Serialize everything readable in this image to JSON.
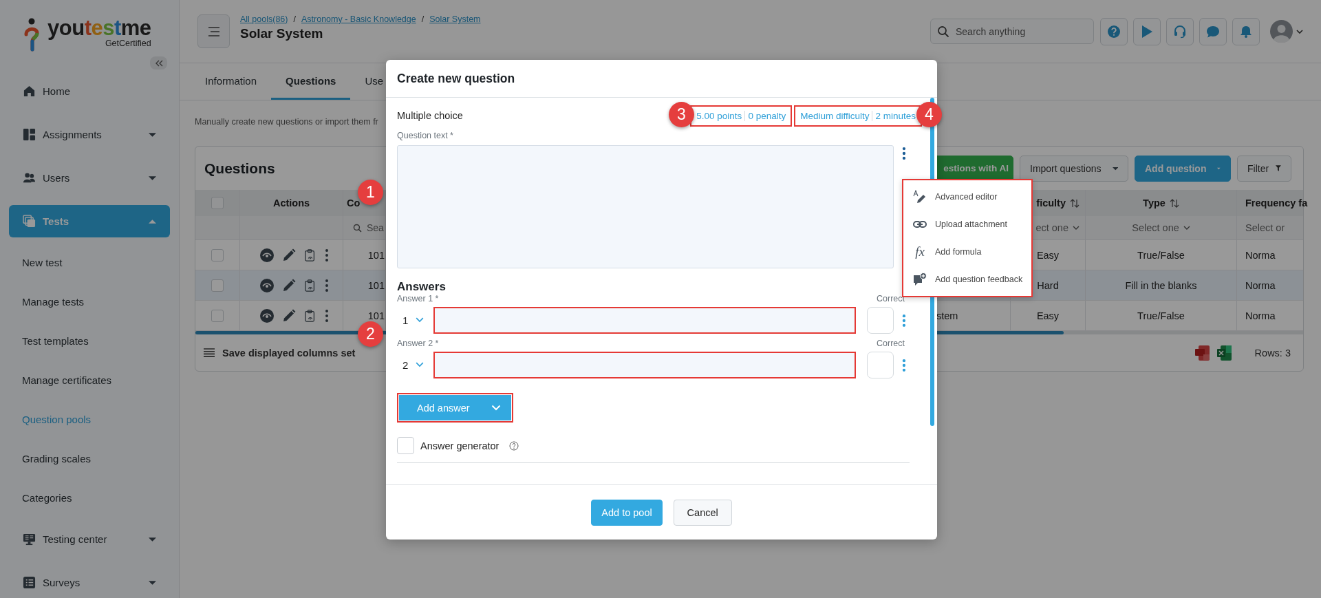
{
  "sidebar": {
    "logo": {
      "parts": [
        "you",
        "test",
        "me"
      ],
      "tagline": "GetCertified"
    },
    "items": [
      {
        "label": "Home",
        "selected": false
      },
      {
        "label": "Assignments",
        "selected": false,
        "expanded": false
      },
      {
        "label": "Users",
        "selected": false,
        "expanded": false
      },
      {
        "label": "Tests",
        "selected": true,
        "expanded": true,
        "children": [
          {
            "label": "New test",
            "selected": false
          },
          {
            "label": "Manage tests",
            "selected": false
          },
          {
            "label": "Test templates",
            "selected": false
          },
          {
            "label": "Manage certificates",
            "selected": false
          },
          {
            "label": "Question pools",
            "selected": true
          },
          {
            "label": "Grading scales",
            "selected": false
          },
          {
            "label": "Categories",
            "selected": false
          }
        ]
      },
      {
        "label": "Testing center",
        "selected": false,
        "expanded": false
      },
      {
        "label": "Surveys",
        "selected": false,
        "expanded": false
      }
    ]
  },
  "header": {
    "breadcrumbs": [
      "All pools(86)",
      "Astronomy - Basic Knowledge",
      "Solar System"
    ],
    "separators": [
      "/",
      "/"
    ],
    "title": "Solar System",
    "search": {
      "placeholder": "Search anything"
    }
  },
  "tabs": [
    {
      "label": "Information",
      "selected": false
    },
    {
      "label": "Questions",
      "selected": true
    },
    {
      "label": "Use",
      "selected": false
    }
  ],
  "description": "Manually create new questions or import them fr",
  "questions_card": {
    "title": "Questions",
    "toolbar": [
      {
        "label": "estions with AI",
        "kind": "ai"
      },
      {
        "label": "Import questions",
        "kind": "dropdown"
      },
      {
        "label": "Add question",
        "kind": "primary"
      },
      {
        "label": "Filter",
        "kind": "filter"
      }
    ],
    "columns": [
      {
        "kind": "select",
        "checked": false
      },
      {
        "kind": "actions",
        "label": "Actions"
      },
      {
        "kind": "code",
        "label": "Co"
      },
      {
        "kind": "difficulty",
        "label": "ficulty",
        "sortable": true
      },
      {
        "kind": "type",
        "label": "Type",
        "sortable": true
      },
      {
        "kind": "frequency",
        "label": "Frequency fa",
        "sortable": false
      }
    ],
    "filters": [
      {
        "kind": "code",
        "placeholder": "Sea"
      },
      {
        "kind": "difficulty",
        "value": "ect one",
        "cut": false
      },
      {
        "kind": "type",
        "value": "Select one",
        "cut": false
      },
      {
        "kind": "frequency",
        "value": "Select or",
        "cut": true
      }
    ],
    "rows": [
      {
        "checked": false,
        "hovered": false,
        "cells": {
          "code": "101",
          "difficulty": "Easy",
          "type": "True/False",
          "frequency": "Norma"
        }
      },
      {
        "checked": false,
        "hovered": true,
        "cells": {
          "code": "101",
          "difficulty": "Hard",
          "type": "Fill in the blanks",
          "frequency": "Norma"
        }
      },
      {
        "checked": false,
        "hovered": false,
        "cells": {
          "code": "101",
          "title": "stem",
          "difficulty": "Easy",
          "type": "True/False",
          "frequency": "Norma"
        }
      }
    ],
    "footer": {
      "save_label": "Save displayed columns set",
      "rows_label": "Rows: 3"
    }
  },
  "dialog": {
    "title": "Create new question",
    "question_type": "Multiple choice",
    "meta_groups": [
      {
        "highlighted": true,
        "links": [
          "5.00 points",
          "0 penalty"
        ]
      },
      {
        "highlighted": true,
        "links": [
          "Medium difficulty",
          "2 minutes"
        ]
      }
    ],
    "question_label": "Question text *",
    "question_menu": {
      "highlighted": true,
      "items": [
        {
          "kind": "editor",
          "label": "Advanced editor"
        },
        {
          "kind": "attachment",
          "label": "Upload attachment"
        },
        {
          "kind": "formula",
          "symbol": "fx",
          "label": "Add formula"
        },
        {
          "kind": "feedback",
          "label": "Add question feedback"
        }
      ]
    },
    "answers_heading": "Answers",
    "answers": [
      {
        "label": "Answer 1 *",
        "number": "1",
        "correct_label": "Correct",
        "checked": false,
        "highlighted": true
      },
      {
        "label": "Answer 2 *",
        "number": "2",
        "correct_label": "Correct",
        "checked": false,
        "highlighted": true
      }
    ],
    "add_answer": {
      "label": "Add answer",
      "highlighted": true
    },
    "answer_generator": {
      "label": "Answer generator",
      "checked": false
    },
    "buttons": [
      {
        "label": "Add to pool",
        "kind": "primary"
      },
      {
        "label": "Cancel",
        "kind": "secondary"
      }
    ]
  },
  "callouts": [
    "1",
    "2",
    "3",
    "4"
  ]
}
